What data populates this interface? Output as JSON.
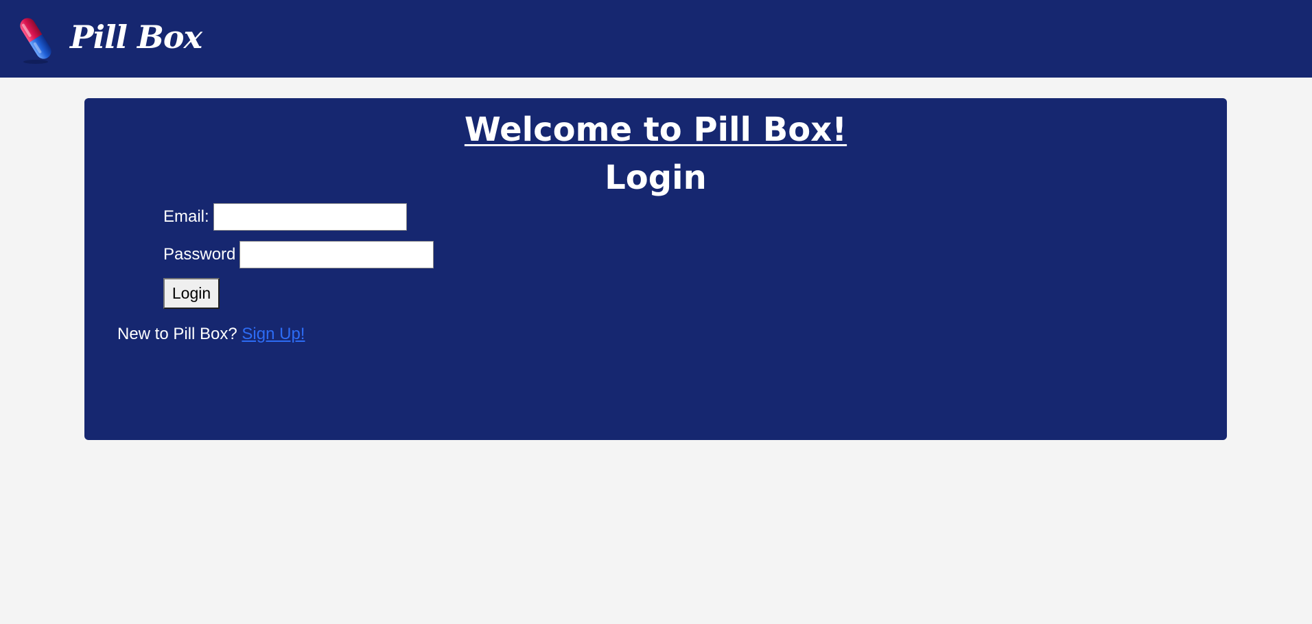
{
  "navbar": {
    "brand": "Pill Box",
    "logo_icon": "pill-capsule-icon",
    "colors": {
      "background": "#162770"
    }
  },
  "card": {
    "welcome_heading": "Welcome to Pill Box!",
    "login_heading": "Login",
    "colors": {
      "background": "#162770",
      "text": "#ffffff"
    }
  },
  "form": {
    "email_label": "Email:",
    "email_value": "",
    "password_label": "Password",
    "password_value": "",
    "login_button": "Login"
  },
  "signup": {
    "prompt": "New to Pill Box?",
    "link": "Sign Up!",
    "link_color": "#2d6cf5"
  }
}
